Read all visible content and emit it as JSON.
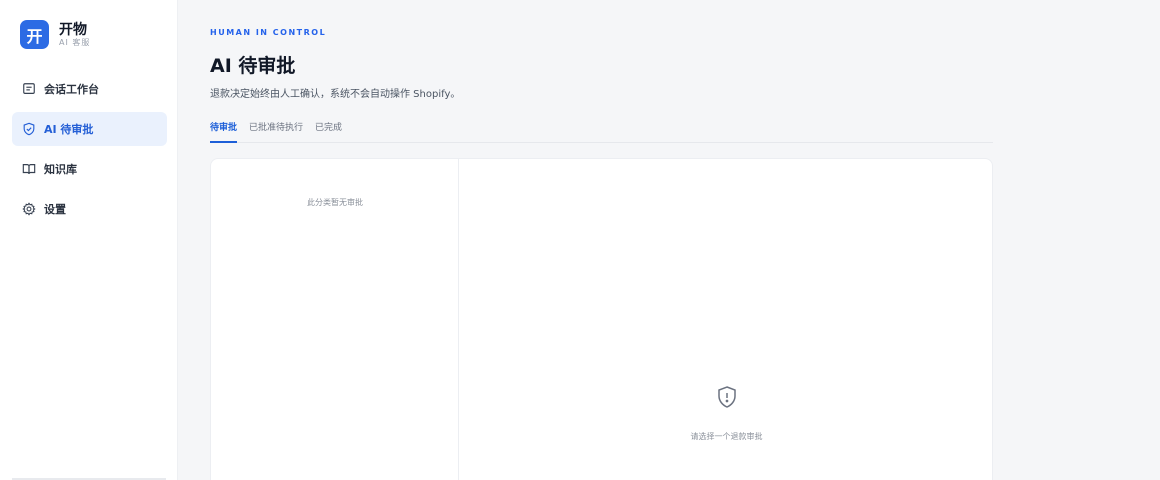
{
  "brand": {
    "logo_char": "开",
    "name": "开物",
    "subtitle": "AI 客服"
  },
  "sidebar": {
    "items": [
      {
        "label": "会话工作台",
        "icon": "message-square-icon",
        "active": false
      },
      {
        "label": "AI 待审批",
        "icon": "shield-check-icon",
        "active": true
      },
      {
        "label": "知识库",
        "icon": "book-open-icon",
        "active": false
      },
      {
        "label": "设置",
        "icon": "gear-icon",
        "active": false
      }
    ]
  },
  "header": {
    "eyebrow": "HUMAN IN CONTROL",
    "title": "AI 待审批",
    "description": "退款决定始终由人工确认，系统不会自动操作 Shopify。"
  },
  "tabs": [
    {
      "label": "待审批",
      "active": true
    },
    {
      "label": "已批准待执行",
      "active": false
    },
    {
      "label": "已完成",
      "active": false
    }
  ],
  "list": {
    "empty_text": "此分类暂无审批"
  },
  "detail": {
    "empty_icon": "shield-alert-icon",
    "empty_text": "请选择一个退款审批"
  },
  "colors": {
    "accent": "#2563eb",
    "active_bg": "#eaf1fd",
    "background": "#f5f6f8"
  }
}
